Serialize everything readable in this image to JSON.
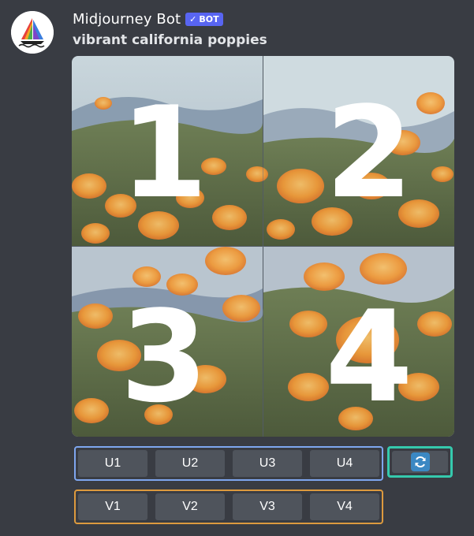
{
  "message": {
    "author": "Midjourney Bot",
    "bot_tag": "BOT",
    "prompt": "vibrant california poppies"
  },
  "image_grid": {
    "labels": [
      "1",
      "2",
      "3",
      "4"
    ]
  },
  "upscale_buttons": [
    "U1",
    "U2",
    "U3",
    "U4"
  ],
  "variation_buttons": [
    "V1",
    "V2",
    "V3",
    "V4"
  ],
  "icons": {
    "avatar": "sailboat-logo",
    "bot_check": "checkmark-icon",
    "reroll": "refresh-icon"
  },
  "colors": {
    "bot_tag": "#5865f2",
    "upscale_outline": "#7ea6ef",
    "variation_outline": "#dd9a3e",
    "reroll_outline": "#35c9ad",
    "button_bg": "#4f545c"
  }
}
